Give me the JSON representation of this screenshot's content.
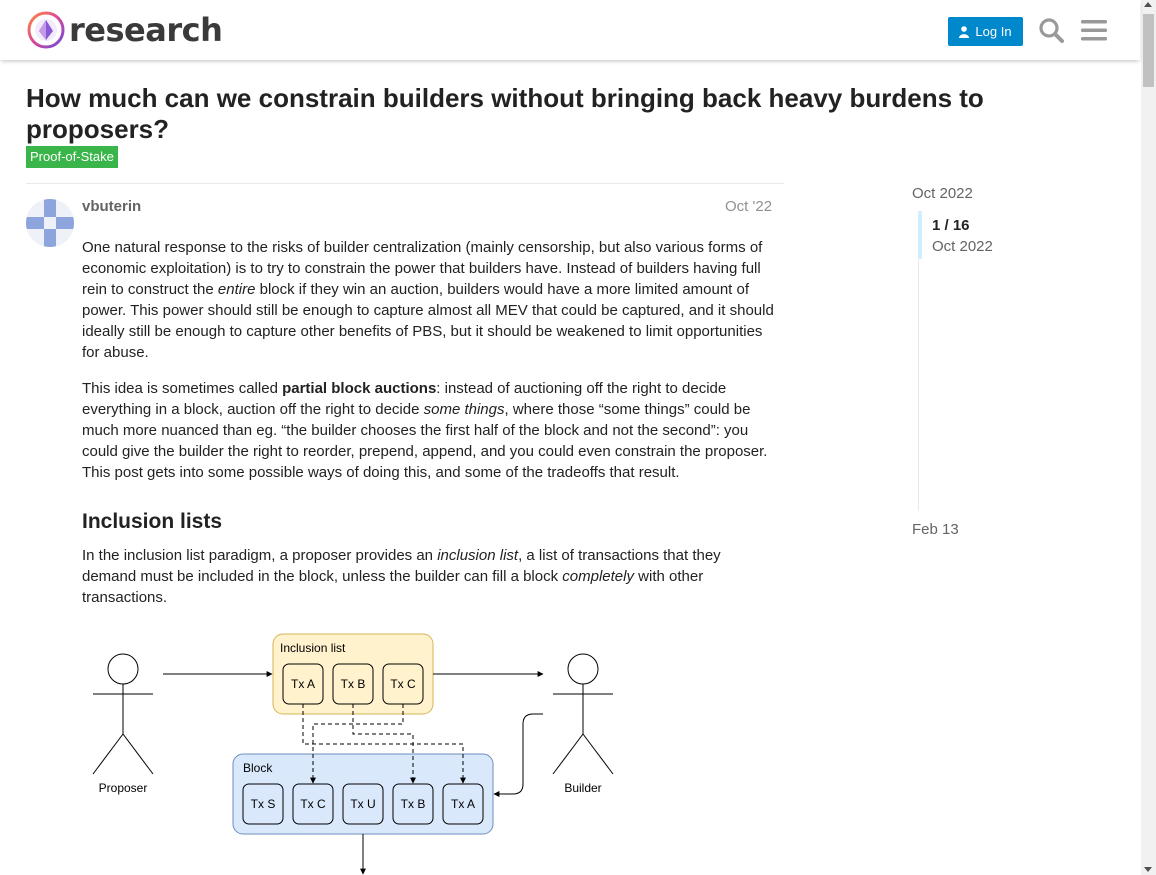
{
  "header": {
    "logo_text": "research",
    "login_label": "Log In",
    "icons": [
      "search-icon",
      "menu-icon"
    ]
  },
  "topic": {
    "title": "How much can we constrain builders without bringing back heavy burdens to proposers?",
    "tag": "Proof-of-Stake"
  },
  "post": {
    "author": "vbuterin",
    "date": "Oct '22",
    "p1": {
      "a": "One natural response to the risks of builder centralization (mainly censorship, but also various forms of economic exploitation) is to try to constrain the power that builders have. Instead of builders having full rein to construct the ",
      "b": "entire",
      "c": " block if they win an auction, builders would have a more limited amount of power. This power should still be enough to capture almost all MEV that could be captured, and it should ideally still be enough to capture other benefits of PBS, but it should be weakened to limit opportunities for abuse."
    },
    "p2": {
      "a": "This idea is sometimes called ",
      "b": "partial block auctions",
      "c": ": instead of auctioning off the right to decide everything in a block, auction off the right to decide ",
      "d": "some things",
      "e": ", where those “some things” could be much more nuanced than eg. “the builder chooses the first half of the block and not the second”: you could give the builder the right to reorder, prepend, append, and you could even constrain the proposer. This post gets into some possible ways of doing this, and some of the tradeoffs that result."
    },
    "heading": "Inclusion lists",
    "p3": {
      "a": "In the inclusion list paradigm, a proposer provides an ",
      "b": "inclusion list",
      "c": ", a list of transactions that they demand must be included in the block, unless the builder can fill a block ",
      "d": "completely",
      "e": " with other transactions."
    }
  },
  "timeline": {
    "start": "Oct 2022",
    "count": "1 / 16",
    "current_date": "Oct 2022",
    "end": "Feb 13"
  },
  "diagram": {
    "proposer_label": "Proposer",
    "builder_label": "Builder",
    "inclusion_list_label": "Inclusion list",
    "inclusion_txs": [
      "Tx A",
      "Tx B",
      "Tx C"
    ],
    "block_label": "Block",
    "block_txs": [
      "Tx S",
      "Tx C",
      "Tx U",
      "Tx B",
      "Tx A"
    ],
    "colors": {
      "inclusion_fill": "#fff2cc",
      "inclusion_stroke": "#d6b656",
      "block_fill": "#dae8fc",
      "block_stroke": "#6c8ebf"
    }
  },
  "colors": {
    "accent": "#0088cc",
    "tag": "#3ab54a"
  }
}
